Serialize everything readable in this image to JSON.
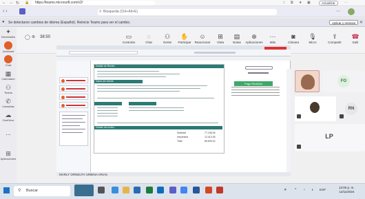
{
  "browser": {
    "url": "https://teams.microsoft.com/v2/",
    "update_label": "Actualizar"
  },
  "teams": {
    "search_placeholder": "Búsqueda (Ctrl+Alt+E)"
  },
  "banner": {
    "text": "Se detectaron cambios de idioma (Español). Reinicie Teams para ver el cambio.",
    "apply_label": "Aplicar y reiniciar"
  },
  "rail": [
    {
      "icon": "pulse-icon",
      "label": "Novedades"
    },
    {
      "icon": "bell-icon",
      "label": "Actividad"
    },
    {
      "icon": "chat-icon",
      "label": "Chat"
    },
    {
      "icon": "calendar-icon",
      "label": "Calendario"
    },
    {
      "icon": "teams-icon",
      "label": "Teams"
    },
    {
      "icon": "call-icon",
      "label": "Llamadas"
    },
    {
      "icon": "onedrive-icon",
      "label": "OneDrive"
    },
    {
      "icon": "more-icon",
      "label": "..."
    },
    {
      "icon": "apps-icon",
      "label": "Aplicaciones"
    }
  ],
  "meeting": {
    "timer": "38:50",
    "toolbar": [
      {
        "icon": "whiteboard-icon",
        "label": "Controlar"
      },
      {
        "icon": "chat-icon",
        "label": "Chat"
      },
      {
        "icon": "people-icon",
        "label": "Gente"
      },
      {
        "icon": "raise-hand-icon",
        "label": "Participar"
      },
      {
        "icon": "react-icon",
        "label": "Reaccionar"
      },
      {
        "icon": "view-icon",
        "label": "Vista"
      },
      {
        "icon": "notes-icon",
        "label": "Notas"
      },
      {
        "icon": "apps-icon",
        "label": "Aplicaciones"
      },
      {
        "icon": "more-icon",
        "label": "Más"
      },
      {
        "icon": "camera-icon",
        "label": "Cámara"
      },
      {
        "icon": "mic-icon",
        "label": "Micro"
      },
      {
        "icon": "share-icon",
        "label": "Compartir"
      },
      {
        "icon": "leave-icon",
        "label": "Salir"
      }
    ]
  },
  "shared_screen": {
    "presenter_name": "MARLY ORNELTH URBINA ARIAS",
    "doc_header": "Detalle de Recibo",
    "section_cliente": "Datos del cliente",
    "green_label": "Pago Recibido",
    "totals_header": "Detalle del recibo",
    "totals": [
      {
        "label": "Subtotal",
        "value": "77,196.06"
      },
      {
        "label": "Impuestos",
        "value": "12,413.36"
      },
      {
        "label": "Total",
        "value": "89,609.42"
      }
    ]
  },
  "participants": [
    {
      "initials": "FO",
      "color": "#e0f0e0",
      "text_color": "#2e7d32"
    },
    {
      "initials": "RN",
      "color": "#e6e6ea",
      "text_color": "#444"
    },
    {
      "initials": "LP",
      "color": "#ffffff",
      "text_color": "#444"
    }
  ],
  "taskbar": {
    "search_placeholder": "Buscar",
    "language": "ESP",
    "time": "12:00 p. m.",
    "date": "12/11/2024"
  },
  "colors": {
    "accent": "#5b5fc7",
    "leave": "#c4314b",
    "doc_header": "#2b7a73"
  }
}
